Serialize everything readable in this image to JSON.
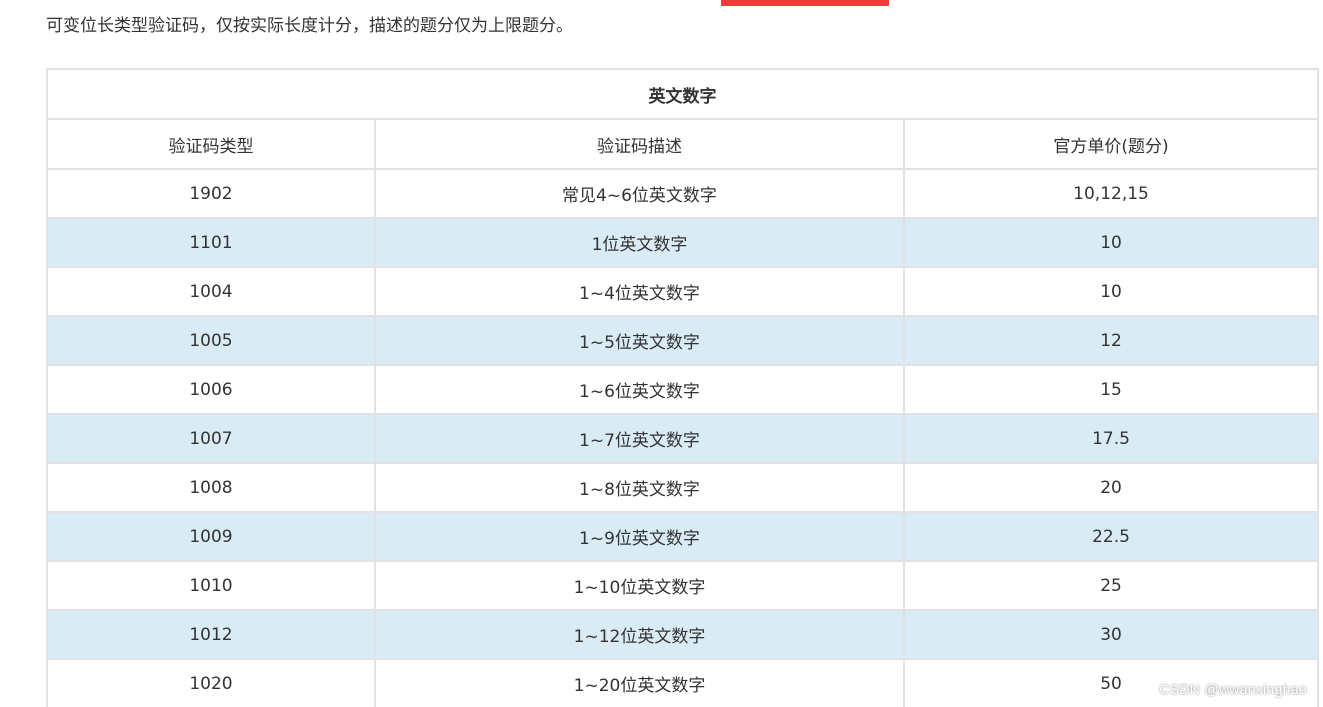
{
  "intro_text": "可变位长类型验证码，仅按实际长度计分，描述的题分仅为上限题分。",
  "table": {
    "caption": "英文数字",
    "headers": [
      "验证码类型",
      "验证码描述",
      "官方单价(题分)"
    ],
    "rows": [
      {
        "type": "1902",
        "desc": "常见4~6位英文数字",
        "price": "10,12,15"
      },
      {
        "type": "1101",
        "desc": "1位英文数字",
        "price": "10"
      },
      {
        "type": "1004",
        "desc": "1~4位英文数字",
        "price": "10"
      },
      {
        "type": "1005",
        "desc": "1~5位英文数字",
        "price": "12"
      },
      {
        "type": "1006",
        "desc": "1~6位英文数字",
        "price": "15"
      },
      {
        "type": "1007",
        "desc": "1~7位英文数字",
        "price": "17.5"
      },
      {
        "type": "1008",
        "desc": "1~8位英文数字",
        "price": "20"
      },
      {
        "type": "1009",
        "desc": "1~9位英文数字",
        "price": "22.5"
      },
      {
        "type": "1010",
        "desc": "1~10位英文数字",
        "price": "25"
      },
      {
        "type": "1012",
        "desc": "1~12位英文数字",
        "price": "30"
      },
      {
        "type": "1020",
        "desc": "1~20位英文数字",
        "price": "50"
      }
    ]
  },
  "watermark": "CSDN @wwanxinghao",
  "colors": {
    "accent_bar": "#e8403a",
    "alt_row": "#d9ecf6",
    "border": "#e2e2e2",
    "text": "#333333"
  }
}
